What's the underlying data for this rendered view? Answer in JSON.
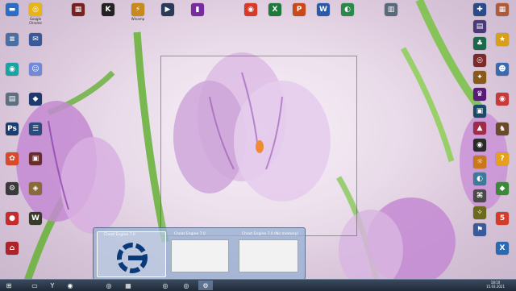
{
  "desktop": {
    "left_icons": [
      {
        "label": "",
        "glyph": "▬",
        "color": "#2b6cc4"
      },
      {
        "label": "",
        "glyph": "≡",
        "color": "#4a6fa5"
      },
      {
        "label": "",
        "glyph": "◉",
        "color": "#1aa3a3"
      },
      {
        "label": "",
        "glyph": "▤",
        "color": "#5c7080"
      },
      {
        "label": "",
        "glyph": "Ps",
        "color": "#1b3e6e"
      },
      {
        "label": "",
        "glyph": "✿",
        "color": "#d84a2a"
      },
      {
        "label": "",
        "glyph": "⚙",
        "color": "#3a3a3a"
      },
      {
        "label": "",
        "glyph": "●",
        "color": "#c42b2b"
      },
      {
        "label": "",
        "glyph": "⌂",
        "color": "#b0222a"
      }
    ],
    "left_col2_icons": [
      {
        "label": "Google Chrome",
        "glyph": "◎",
        "color": "#e8b517"
      },
      {
        "label": "",
        "glyph": "✉",
        "color": "#3b5998"
      },
      {
        "label": "",
        "glyph": "☺",
        "color": "#7289da"
      },
      {
        "label": "",
        "glyph": "◆",
        "color": "#1e3a6e"
      },
      {
        "label": "",
        "glyph": "☰",
        "color": "#2e4a7a"
      },
      {
        "label": "",
        "glyph": "▣",
        "color": "#6b2c2c"
      },
      {
        "label": "",
        "glyph": "◈",
        "color": "#8a6a3a"
      },
      {
        "label": "",
        "glyph": "W",
        "color": "#3a3a2a"
      }
    ],
    "top_icons": [
      {
        "label": "",
        "glyph": "▦",
        "color": "#7a2020"
      },
      {
        "label": "",
        "glyph": "K",
        "color": "#222222"
      },
      {
        "label": "Winamp",
        "glyph": "⚡",
        "color": "#c88a1a"
      },
      {
        "label": "",
        "glyph": "▶",
        "color": "#2a3a5a"
      },
      {
        "label": "",
        "glyph": "▮",
        "color": "#7a2aa0"
      },
      {
        "label": "",
        "glyph": "◉",
        "color": "#d83a2a"
      },
      {
        "label": "",
        "glyph": "X",
        "color": "#1d7a3a"
      },
      {
        "label": "",
        "glyph": "P",
        "color": "#c84a1a"
      },
      {
        "label": "",
        "glyph": "W",
        "color": "#2b5aa8"
      },
      {
        "label": "",
        "glyph": "◐",
        "color": "#2a8a4a"
      },
      {
        "label": "",
        "glyph": "▥",
        "color": "#5a6a7a"
      }
    ],
    "right_icons": [
      {
        "label": "",
        "glyph": "▦",
        "color": "#b05a3a"
      },
      {
        "label": "",
        "glyph": "★",
        "color": "#d8a018"
      },
      {
        "label": "",
        "glyph": "☻",
        "color": "#3a6ab0"
      },
      {
        "label": "",
        "glyph": "◉",
        "color": "#c83a3a"
      },
      {
        "label": "",
        "glyph": "♞",
        "color": "#6a4a2a"
      },
      {
        "label": "",
        "glyph": "?",
        "color": "#e8a018"
      },
      {
        "label": "",
        "glyph": "◆",
        "color": "#3a8a3a"
      },
      {
        "label": "",
        "glyph": "5",
        "color": "#d83a2a"
      },
      {
        "label": "",
        "glyph": "X",
        "color": "#2a6ab0"
      }
    ],
    "right_col2_icons": [
      {
        "label": "",
        "glyph": "✚",
        "color": "#2a4a8a"
      },
      {
        "label": "",
        "glyph": "▤",
        "color": "#4a3a7a"
      },
      {
        "label": "",
        "glyph": "♣",
        "color": "#1a6a4a"
      },
      {
        "label": "",
        "glyph": "◎",
        "color": "#7a2a2a"
      },
      {
        "label": "",
        "glyph": "✦",
        "color": "#8a5a1a"
      },
      {
        "label": "",
        "glyph": "♛",
        "color": "#5a1a7a"
      },
      {
        "label": "",
        "glyph": "▣",
        "color": "#1a4a6a"
      },
      {
        "label": "",
        "glyph": "▲",
        "color": "#a02a4a"
      },
      {
        "label": "",
        "glyph": "◉",
        "color": "#2a2a2a"
      },
      {
        "label": "",
        "glyph": "☼",
        "color": "#c8781a"
      },
      {
        "label": "",
        "glyph": "◐",
        "color": "#3a7a9a"
      },
      {
        "label": "",
        "glyph": "⌘",
        "color": "#4a4a4a"
      },
      {
        "label": "",
        "glyph": "✧",
        "color": "#6a6a1a"
      },
      {
        "label": "",
        "glyph": "⚑",
        "color": "#3a5a9a"
      }
    ]
  },
  "thumbnails": [
    {
      "title": "Cheat Engine 7.0",
      "kind": "logo"
    },
    {
      "title": "Cheat Engine 7.0",
      "kind": "window"
    },
    {
      "title": "Cheat Engine 7.0 (No memory)",
      "kind": "window"
    }
  ],
  "taskbar": {
    "buttons": [
      {
        "glyph": "⊞",
        "name": "start-button-icon"
      },
      {
        "glyph": "▭",
        "name": "explorer-icon"
      },
      {
        "glyph": "Y",
        "name": "yandex-icon"
      },
      {
        "glyph": "◉",
        "name": "opera-icon"
      },
      {
        "glyph": "◎",
        "name": "obs-icon"
      },
      {
        "glyph": "▦",
        "name": "app-icon"
      },
      {
        "glyph": "◎",
        "name": "chrome-icon"
      },
      {
        "glyph": "◎",
        "name": "obs-icon-2"
      },
      {
        "glyph": "⚙",
        "name": "cheat-engine-icon"
      }
    ],
    "clock_time": "18:10",
    "clock_date": "15.03.2021"
  },
  "colors": {
    "taskbar": "#2a3648",
    "peek_border": "#505050",
    "thumb_strip": "#96afd2"
  }
}
